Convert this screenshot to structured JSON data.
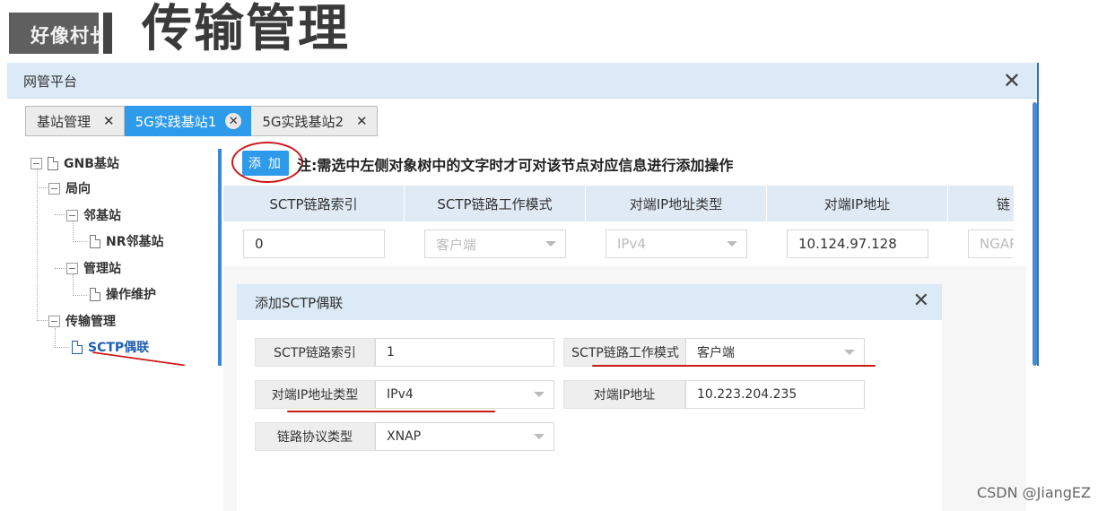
{
  "banner": {
    "badge_text": "好像村长",
    "title": "传输管理"
  },
  "window": {
    "title": "网管平台",
    "close_glyph": "✕"
  },
  "tabs": [
    {
      "label": "基站管理",
      "close": "✕",
      "active": false
    },
    {
      "label": "5G实践基站1",
      "close": "✕",
      "active": true
    },
    {
      "label": "5G实践基站2",
      "close": "✕",
      "active": false
    }
  ],
  "tree": {
    "root": "GNB基站",
    "n1": "局向",
    "n2": "邻基站",
    "n3": "NR邻基站",
    "n4": "管理站",
    "n5": "操作维护",
    "n6": "传输管理",
    "n7": "SCTP偶联",
    "expander": "−"
  },
  "toolbar": {
    "add_label": "添 加",
    "note": "注:需选中左侧对象树中的文字时才可对该节点对应信息进行添加操作"
  },
  "grid": {
    "headers": [
      "SCTP链路索引",
      "SCTP链路工作模式",
      "对端IP地址类型",
      "对端IP地址",
      "链"
    ],
    "row": [
      "0",
      "客户端",
      "IPv4",
      "10.124.97.128",
      "NGAP"
    ]
  },
  "dialog": {
    "title": "添加SCTP偶联",
    "close_glyph": "✕",
    "fields": {
      "index_label": "SCTP链路索引",
      "index_value": "1",
      "mode_label": "SCTP链路工作模式",
      "mode_value": "客户端",
      "iptype_label": "对端IP地址类型",
      "iptype_value": "IPv4",
      "ip_label": "对端IP地址",
      "ip_value": "10.223.204.235",
      "proto_label": "链路协议类型",
      "proto_value": "XNAP"
    }
  },
  "watermark": "CSDN @JiangEZ",
  "colors": {
    "accent": "#2e9aea",
    "header_bg": "#dbeaf6",
    "annotation_red": "#cc1a1a"
  }
}
